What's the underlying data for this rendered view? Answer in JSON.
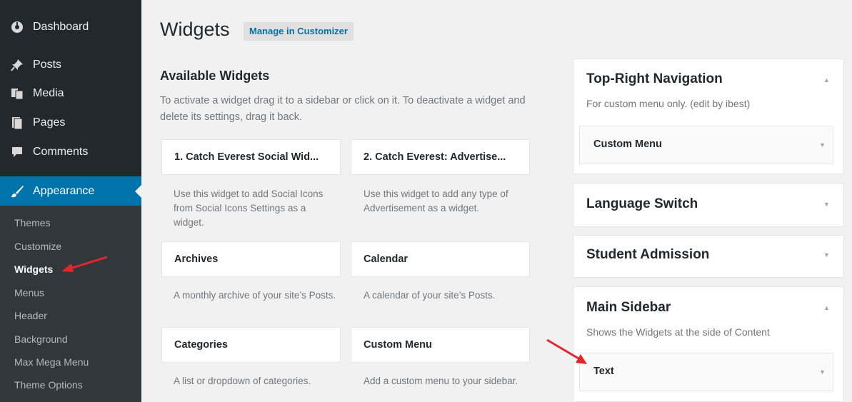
{
  "sidebar": {
    "items": [
      {
        "label": "Dashboard",
        "icon": "dashboard-icon"
      },
      {
        "label": "Posts",
        "icon": "pin-icon"
      },
      {
        "label": "Media",
        "icon": "media-icon"
      },
      {
        "label": "Pages",
        "icon": "pages-icon"
      },
      {
        "label": "Comments",
        "icon": "comment-icon"
      },
      {
        "label": "Appearance",
        "icon": "brush-icon"
      }
    ],
    "submenu": [
      "Themes",
      "Customize",
      "Widgets",
      "Menus",
      "Header",
      "Background",
      "Max Mega Menu",
      "Theme Options"
    ],
    "active_color": "#0073aa"
  },
  "header": {
    "title": "Widgets",
    "customizer_button": "Manage in Customizer"
  },
  "available": {
    "title": "Available Widgets",
    "description": "To activate a widget drag it to a sidebar or click on it. To deactivate a widget and delete its settings, drag it back.",
    "widgets": [
      {
        "title": "1. Catch Everest Social Wid...",
        "desc": "Use this widget to add Social Icons from Social Icons Settings as a widget."
      },
      {
        "title": "2. Catch Everest: Advertise...",
        "desc": "Use this widget to add any type of Advertisement as a widget."
      },
      {
        "title": "Archives",
        "desc": "A monthly archive of your site’s Posts."
      },
      {
        "title": "Calendar",
        "desc": "A calendar of your site’s Posts."
      },
      {
        "title": "Categories",
        "desc": "A list or dropdown of categories."
      },
      {
        "title": "Custom Menu",
        "desc": "Add a custom menu to your sidebar."
      }
    ]
  },
  "sidebars": [
    {
      "title": "Top-Right Navigation",
      "desc": "For custom menu only. (edit by ibest)",
      "widget": "Custom Menu",
      "expanded": true
    },
    {
      "title": "Language Switch",
      "expanded": false
    },
    {
      "title": "Student Admission",
      "expanded": false
    },
    {
      "title": "Main Sidebar",
      "desc": "Shows the Widgets at the side of Content",
      "widget": "Text",
      "expanded": true
    }
  ],
  "arrow_color": "#e3262c"
}
